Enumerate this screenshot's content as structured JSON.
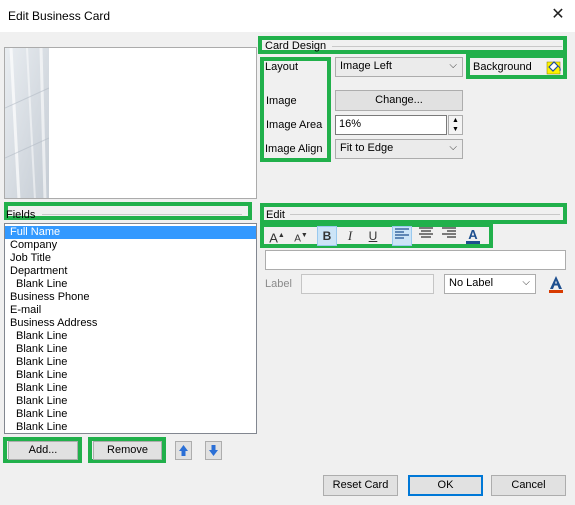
{
  "window": {
    "title": "Edit Business Card",
    "close_glyph": "✕"
  },
  "card_design": {
    "group_label": "Card Design",
    "layout_label": "Layout",
    "layout_value": "Image Left",
    "background_label": "Background",
    "image_label": "Image",
    "change_button": "Change...",
    "image_area_label": "Image Area",
    "image_area_value": "16%",
    "image_align_label": "Image Align",
    "image_align_value": "Fit to Edge"
  },
  "fields": {
    "group_label": "Fields",
    "items": [
      "Full Name",
      "Company",
      "Job Title",
      "Department",
      "Blank Line",
      "Business Phone",
      "E-mail",
      "Business Address",
      "Blank Line",
      "Blank Line",
      "Blank Line",
      "Blank Line",
      "Blank Line",
      "Blank Line",
      "Blank Line",
      "Blank Line"
    ],
    "selected_index": 0,
    "add_button": "Add...",
    "remove_button": "Remove"
  },
  "edit": {
    "group_label": "Edit",
    "toolbar": {
      "grow_font": "A",
      "shrink_font": "A",
      "bold": "B",
      "italic": "I",
      "underline": "U",
      "font_color": "A"
    },
    "text_value": "",
    "label_caption": "Label",
    "label_value": "",
    "label_position": "No Label"
  },
  "footer": {
    "reset_button": "Reset Card",
    "ok_button": "OK",
    "cancel_button": "Cancel"
  },
  "colors": {
    "highlight": "#21b04b",
    "selection": "#3399ff",
    "ok_border": "#0078d7"
  }
}
